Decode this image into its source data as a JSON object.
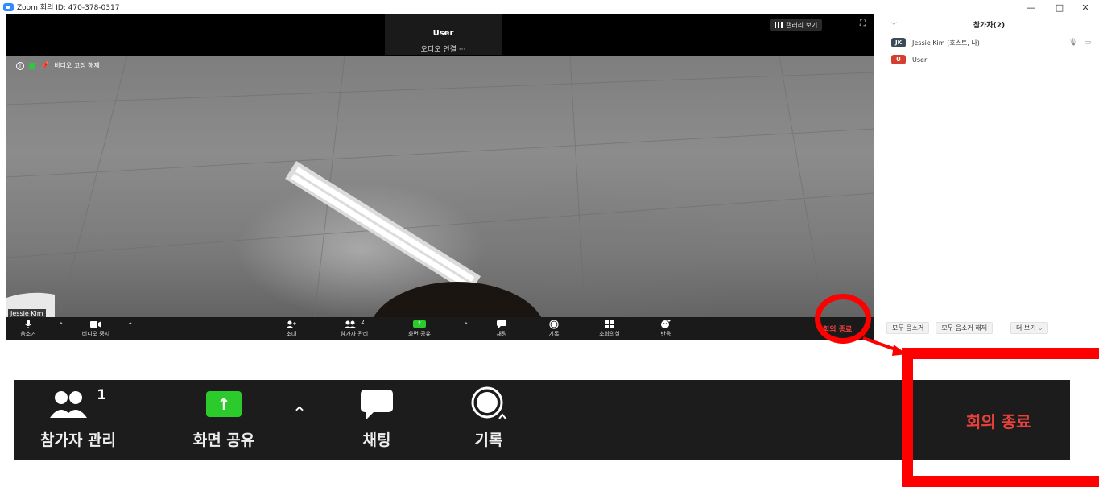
{
  "window": {
    "title": "Zoom 회의 ID: 470-378-0317",
    "minimize": "—",
    "maximize": "□",
    "close": "✕"
  },
  "video": {
    "active_speaker": "User",
    "speaker_audio": "오디오 연결 ···",
    "gallery_label": "갤러리 보기",
    "fullscreen": "⛶",
    "unpin_label": "비디오 고정 해제",
    "self_name": "Jessie Kim"
  },
  "toolbar": {
    "mute": "음소거",
    "stop_video": "비디오 중지",
    "invite": "초대",
    "participants": "참가자 관리",
    "participants_count": "2",
    "share": "화면 공유",
    "chat": "채팅",
    "record": "기록",
    "breakout": "소회의실",
    "reactions": "반응",
    "end": "회의 종료"
  },
  "panel": {
    "title": "참가자(2)",
    "participants": [
      {
        "initials": "JK",
        "name": "Jessie Kim (호스트, 나)",
        "color": "#3d4a5a"
      },
      {
        "initials": "U",
        "name": "User",
        "color": "#d43f2f"
      }
    ],
    "buttons": [
      "모두 음소거",
      "모두 음소거 해제",
      "더 보기 ⌵"
    ]
  },
  "zoomed": {
    "participants": "참가자 관리",
    "participants_count": "1",
    "share": "화면 공유",
    "chat": "채팅",
    "record": "기록",
    "end": "회의 종료"
  },
  "colors": {
    "end_red": "#e8413b",
    "share_green": "#2bcb2b",
    "annotation_red": "#ff0000"
  },
  "icons": [
    "zoom-logo-icon",
    "info-icon",
    "lock-icon",
    "pin-icon",
    "grid-icon",
    "mic-icon",
    "video-icon",
    "invite-icon",
    "participants-icon",
    "share-arrow-icon",
    "chat-icon",
    "record-icon",
    "breakout-icon",
    "reaction-icon",
    "caret-up-icon",
    "chevron-down-icon"
  ]
}
